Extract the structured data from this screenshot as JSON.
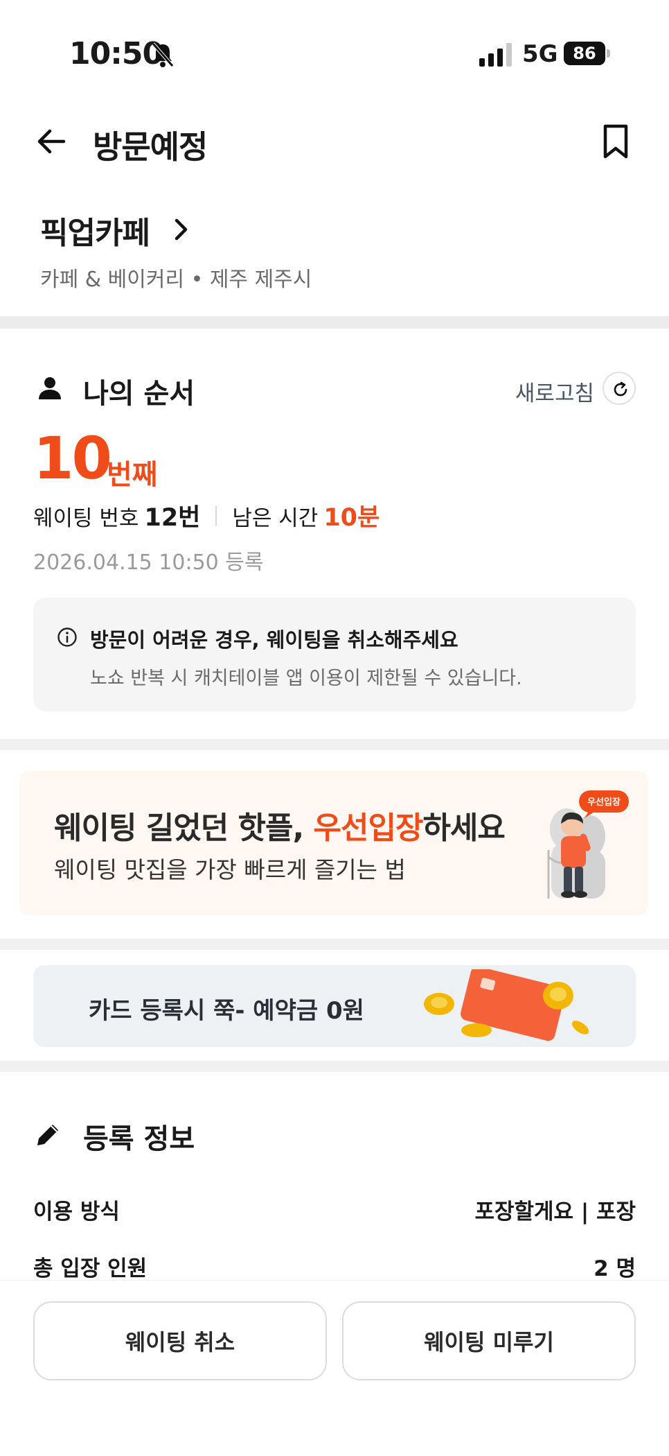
{
  "status_bar": {
    "time": "10:50",
    "network": "5G",
    "battery": "86"
  },
  "header": {
    "title": "방문예정"
  },
  "store": {
    "name": "픽업카페",
    "category_location": "카페 & 베이커리 • 제주 제주시"
  },
  "my_order": {
    "title": "나의 순서",
    "refresh_label": "새로고침",
    "rank": "10",
    "rank_unit": "번째",
    "waiting_number_label": "웨이팅 번호",
    "waiting_number": "12번",
    "remaining_time_label": "남은 시간",
    "remaining_time": "10분",
    "registered_at": "2026.04.15 10:50 등록"
  },
  "notice": {
    "title": "방문이 어려운 경우, 웨이팅을 취소해주세요",
    "description": "노쇼 반복 시 캐치테이블 앱 이용이 제한될 수 있습니다."
  },
  "promo_banner": {
    "title_part1": "웨이팅 길었던 핫플, ",
    "title_accent": "우선입장",
    "title_part2": "하세요",
    "subtitle": "웨이팅 맛집을 가장 빠르게 즐기는 법",
    "badge": "우선입장"
  },
  "card_banner": {
    "text": "카드 등록시 쭉- 예약금 0원"
  },
  "registration": {
    "title": "등록 정보",
    "rows": [
      {
        "label": "이용 방식",
        "value": "포장할게요 | 포장"
      },
      {
        "label": "총 입장 인원",
        "value": "2 명"
      }
    ]
  },
  "actions": {
    "cancel": "웨이팅 취소",
    "delay": "웨이팅 미루기"
  },
  "colors": {
    "accent": "#f04c1a",
    "muted": "#9a9a9a",
    "card_orange": "#f4623a"
  }
}
